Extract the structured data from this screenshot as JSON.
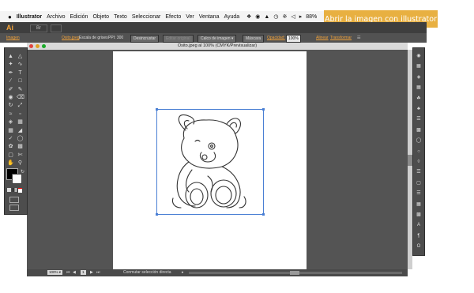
{
  "menubar": {
    "apple": "",
    "items": [
      "Illustrator",
      "Archivo",
      "Edición",
      "Objeto",
      "Texto",
      "Seleccionar",
      "Efecto",
      "Ver",
      "Ventana",
      "Ayuda"
    ],
    "battery": "88%"
  },
  "callout": {
    "text": "Abrir la imagen con illustrator"
  },
  "appbar": {
    "logo": "Ai",
    "bridge": "Br"
  },
  "controlbar": {
    "label_imagen": "Imagen",
    "file_name": "Osito.jpeg",
    "color_mode": "Escala de grises",
    "ppi": "PPI: 300",
    "unlink_button": "Desincrustar",
    "edit_original_button": "Editar original",
    "live_trace_label": "Calco de imagen",
    "mask_button": "Máscara",
    "opacity_label": "Opacidad:",
    "opacity_value": "100%",
    "align_label": "Alinear",
    "transform_label": "Transformar"
  },
  "document": {
    "tab_title": "Osito.jpeg al 100% (CMYK/Previsualizar)"
  },
  "statusbar": {
    "zoom": "100%",
    "page": "1",
    "tool_hint": "Conmutar selección directa"
  },
  "colors": {
    "accent": "#f3a33a",
    "callout": "#e8b041",
    "selection": "#4a7fd4",
    "window_close": "#e0443e",
    "window_min": "#dea123",
    "window_zoom": "#1aab29"
  },
  "tools": {
    "icons": [
      "selection-arrow-icon",
      "direct-selection-icon",
      "magic-wand-icon",
      "lasso-icon",
      "pen-icon",
      "type-icon",
      "line-icon",
      "rectangle-icon",
      "paintbrush-icon",
      "pencil-icon",
      "blob-brush-icon",
      "eraser-icon",
      "rotate-icon",
      "scale-icon",
      "width-icon",
      "free-transform-icon",
      "shape-builder-icon",
      "perspective-icon",
      "mesh-icon",
      "gradient-icon",
      "eyedropper-icon",
      "blend-icon",
      "symbol-sprayer-icon",
      "column-graph-icon",
      "artboard-icon",
      "slice-icon",
      "hand-icon",
      "zoom-icon"
    ]
  },
  "rightpanel": {
    "icons": [
      "color-icon",
      "color-guide-icon",
      "kuler-icon",
      "swatches-icon",
      "brushes-icon",
      "symbols-icon",
      "stroke-icon",
      "gradient-icon",
      "transparency-icon",
      "appearance-icon",
      "graphic-styles-icon",
      "layers-icon",
      "artboards-icon",
      "align-icon",
      "transform-icon",
      "pathfinder-icon",
      "character-icon",
      "paragraph-icon",
      "opentype-icon"
    ]
  }
}
